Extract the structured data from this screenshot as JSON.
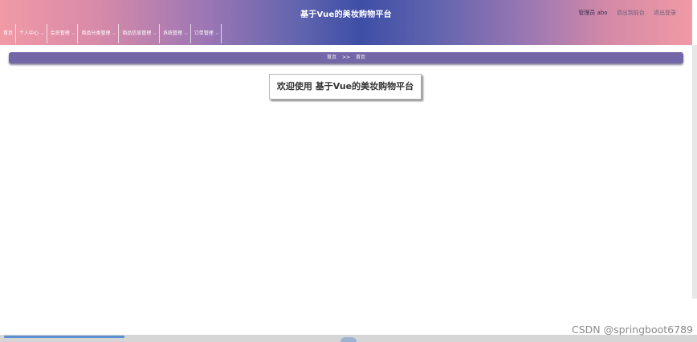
{
  "header": {
    "title": "基于Vue的美妆购物平台",
    "user": "管理员 abo",
    "back_to_front": "退出到前台",
    "logout": "退出登录"
  },
  "nav": {
    "items": [
      {
        "label": "首页",
        "has_dropdown": false
      },
      {
        "label": "个人中心",
        "has_dropdown": true
      },
      {
        "label": "会员管理",
        "has_dropdown": true
      },
      {
        "label": "商品分类管理",
        "has_dropdown": true
      },
      {
        "label": "商品信息管理",
        "has_dropdown": true
      },
      {
        "label": "系统管理",
        "has_dropdown": true
      },
      {
        "label": "订单管理",
        "has_dropdown": true
      }
    ],
    "dropdown_glyph": "⌵"
  },
  "breadcrumb": {
    "root": "首页",
    "separator": ">>",
    "current": "首页"
  },
  "welcome": {
    "text": "欢迎使用 基于Vue的美妆购物平台"
  },
  "watermark": "CSDN @springboot6789",
  "colors": {
    "header_gradient_edge": "#f19aa6",
    "header_gradient_center": "#3e4ea6",
    "breadcrumb_bg": "#7467a8"
  }
}
